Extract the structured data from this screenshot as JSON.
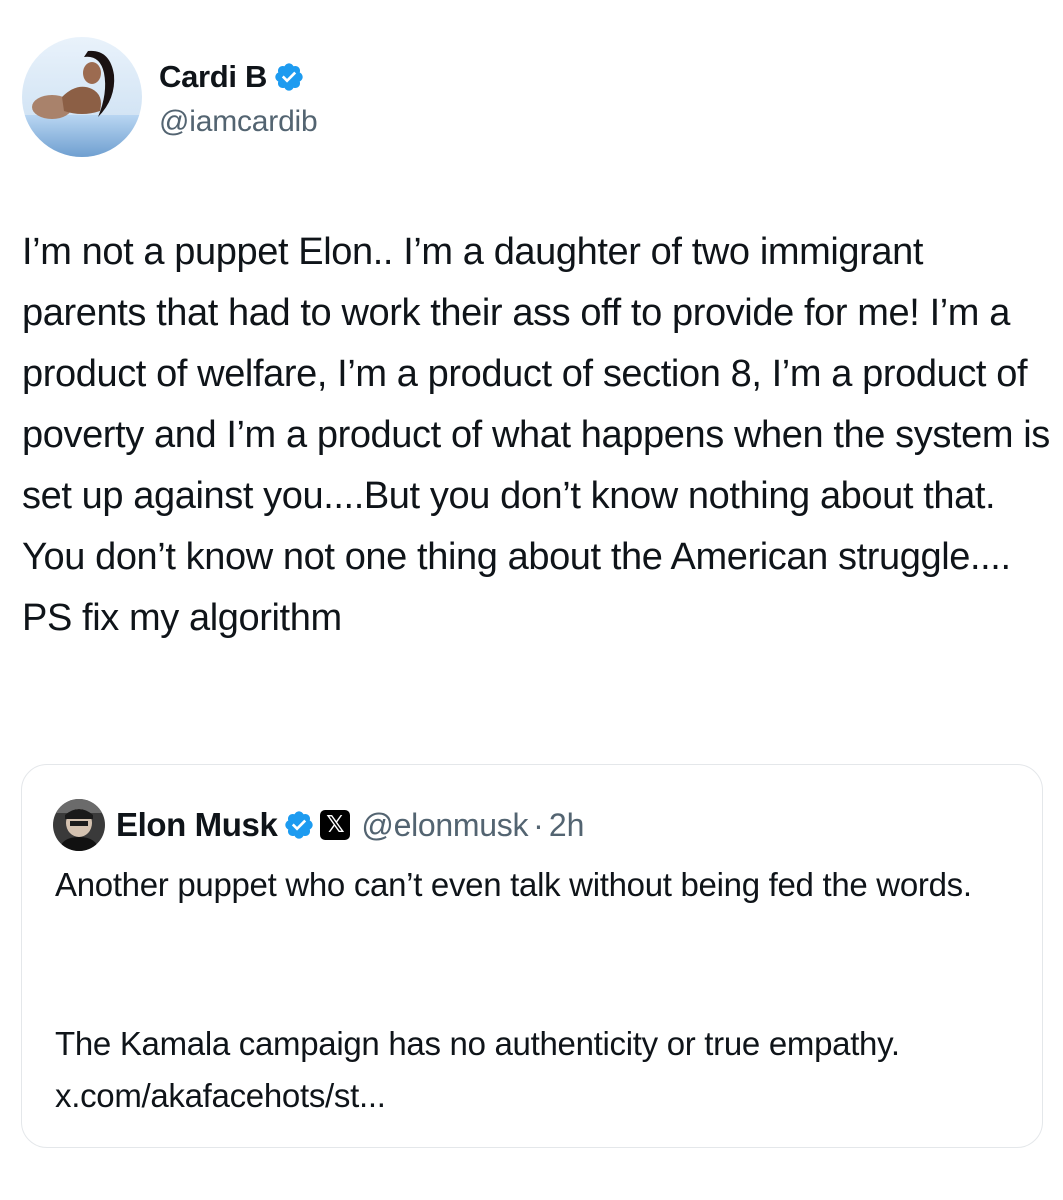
{
  "post": {
    "author": {
      "display_name": "Cardi B",
      "handle": "@iamcardib",
      "verified_icon": "verified-badge-icon",
      "avatar": "profile-photo"
    },
    "text": "I’m not a puppet Elon.. I’m a daughter of two immigrant parents that had to work their ass off to provide for me! I’m a product of welfare, I’m a product of section 8, I’m a product of poverty and I’m a product of what happens when the system is set up against you....But you don’t know nothing about that. You don’t know not one thing about the American struggle.... PS fix my algorithm"
  },
  "quoted_post": {
    "author": {
      "display_name": "Elon Musk",
      "handle": "@elonmusk",
      "verified_icon": "verified-badge-icon",
      "affiliate_icon": "x-logo-icon",
      "affiliate_glyph": "𝕏"
    },
    "separator": "·",
    "time": "2h",
    "paragraph_1": "Another puppet who can’t even talk without being fed the words.",
    "paragraph_2": "The Kamala campaign has no authenticity or true empathy. x.com/akafacehots/st..."
  },
  "colors": {
    "verified_blue": "#1d9bf0",
    "text_primary": "#0f1419",
    "text_secondary": "#536471",
    "card_border": "#e4e7ea"
  }
}
